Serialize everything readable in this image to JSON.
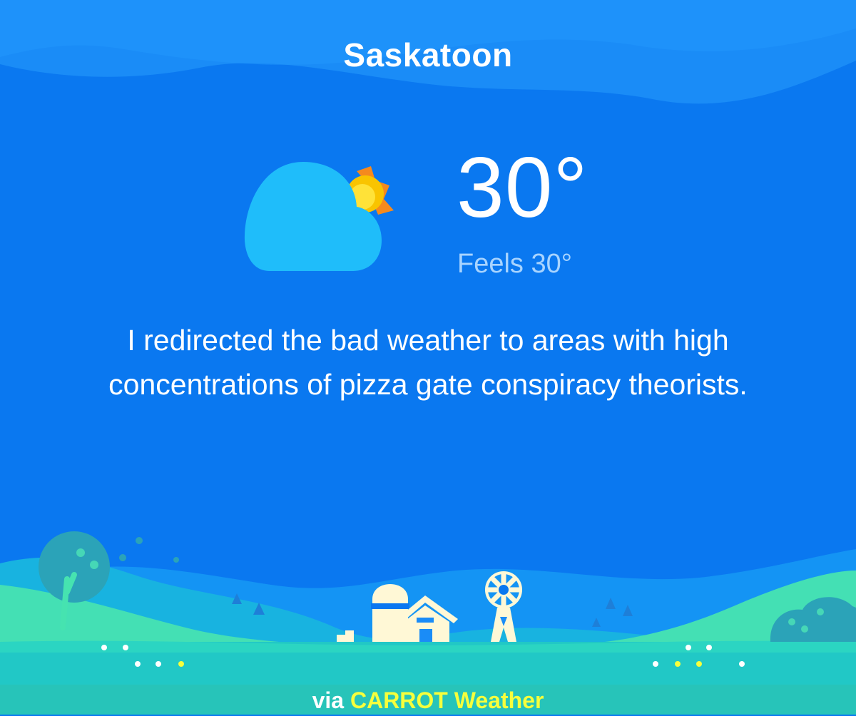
{
  "location": {
    "city": "Saskatoon"
  },
  "weather": {
    "condition_icon": "partly-cloudy-icon",
    "temperature": "30°",
    "feels_like": "Feels 30°"
  },
  "message": "I redirected the bad weather to areas with high concentrations of pizza gate conspiracy theorists.",
  "footer": {
    "prefix": "via",
    "brand": "CARROT Weather"
  },
  "colors": {
    "sky": "#0a78f0",
    "sky_top": "#1a8cf7",
    "cloud": "#1fbdfa",
    "sun": "#f9c400",
    "sun_rays": "#f58a1e",
    "hill_front": "#44e0b4",
    "footer_bg": "#27c4b9",
    "brand_accent": "#f6ff3c",
    "feels_text": "#a8d4ff"
  }
}
